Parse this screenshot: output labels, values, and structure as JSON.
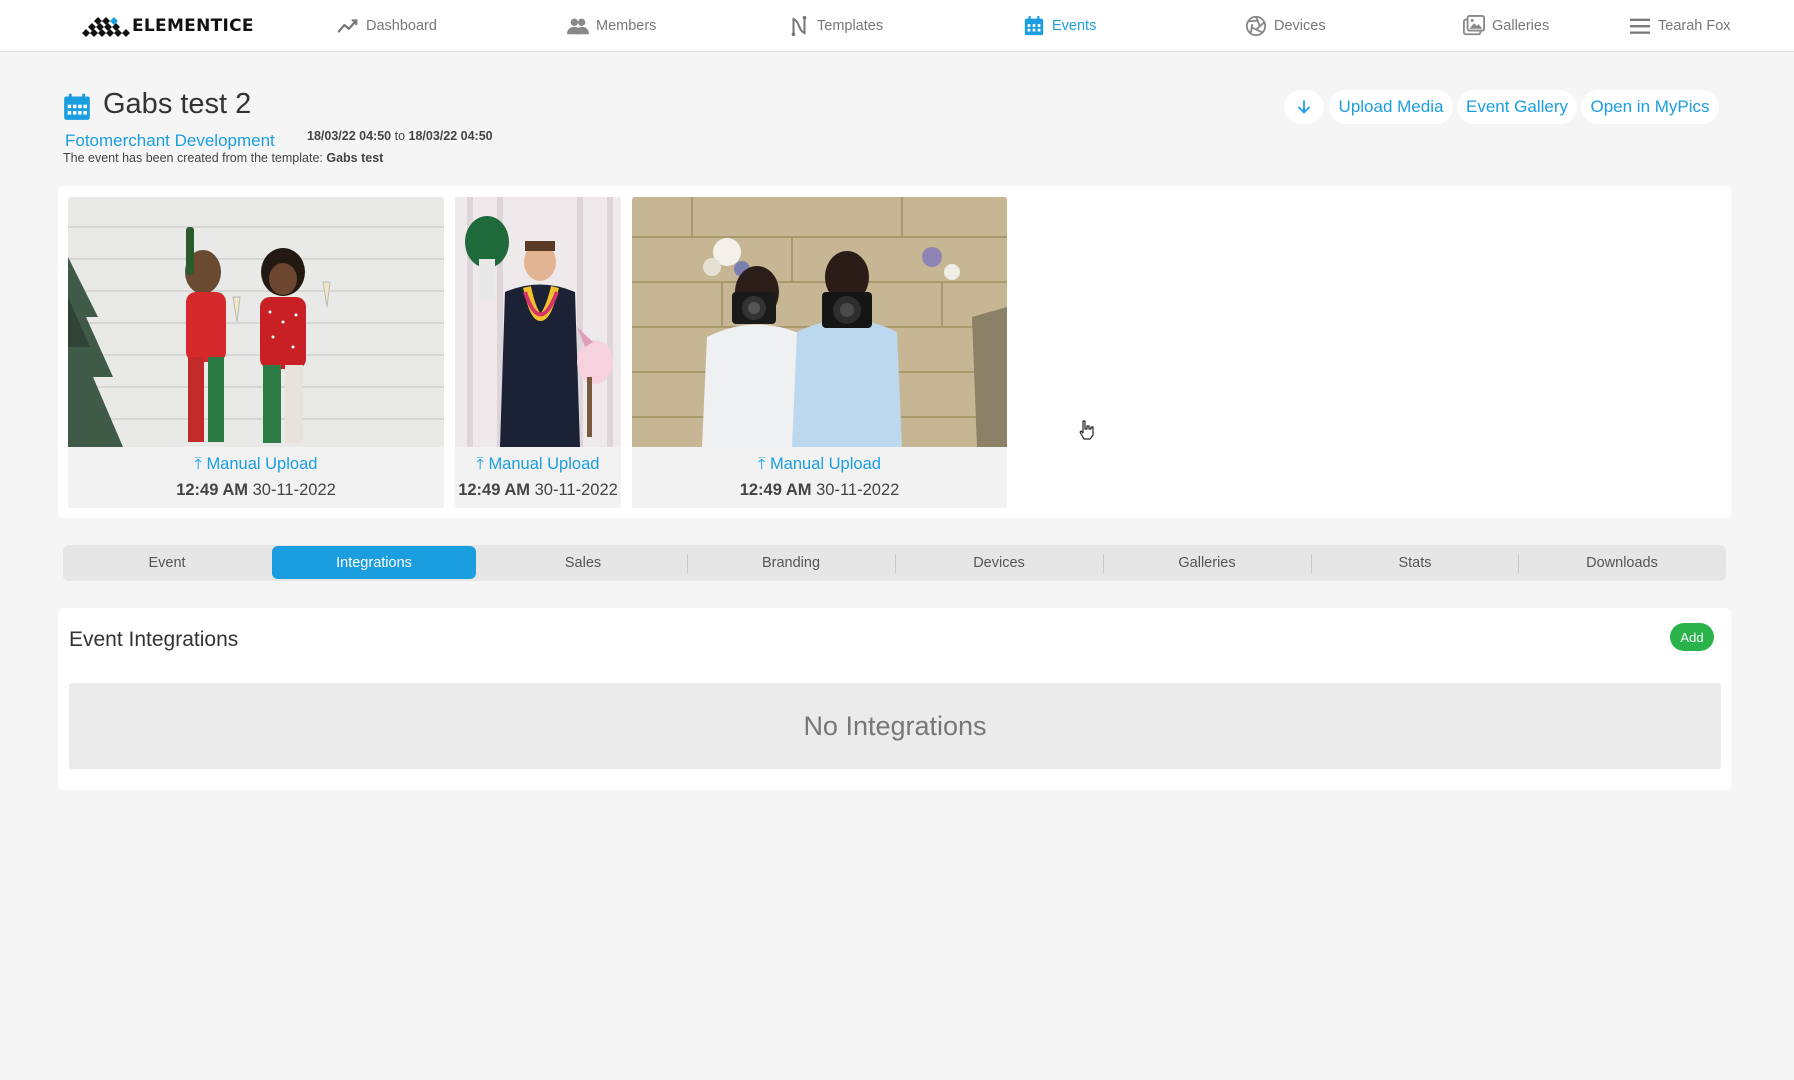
{
  "nav": {
    "brand": "ELEMENTICE",
    "items": [
      {
        "label": "Dashboard",
        "icon": "chart-line-icon"
      },
      {
        "label": "Members",
        "icon": "users-icon"
      },
      {
        "label": "Templates",
        "icon": "templates-icon"
      },
      {
        "label": "Events",
        "icon": "calendar-icon",
        "active": true
      },
      {
        "label": "Devices",
        "icon": "camera-aperture-icon"
      },
      {
        "label": "Galleries",
        "icon": "image-gallery-icon"
      }
    ],
    "user": "Tearah Fox"
  },
  "event": {
    "title": "Gabs test 2",
    "organization": "Fotomerchant Development",
    "start": "18/03/22 04:50",
    "to": "to",
    "end": "18/03/22 04:50",
    "template_prefix": "The event has been created from the template:",
    "template_name": "Gabs test"
  },
  "actions": {
    "download_icon": "arrow-down-icon",
    "upload_media": "Upload Media",
    "event_gallery": "Event Gallery",
    "open_in_mypics": "Open in MyPics"
  },
  "media": [
    {
      "source": "Manual Upload",
      "time": "12:49 AM",
      "date": "30-11-2022",
      "subject": "two women in red christmas sweaters holding champagne"
    },
    {
      "source": "Manual Upload",
      "time": "12:49 AM",
      "date": "30-11-2022",
      "subject": "man with boxing glove and lei holding unicorn"
    },
    {
      "source": "Manual Upload",
      "time": "12:49 AM",
      "date": "30-11-2022",
      "subject": "two men holding cameras in front of stone wall"
    }
  ],
  "tabs": [
    "Event",
    "Integrations",
    "Sales",
    "Branding",
    "Devices",
    "Galleries",
    "Stats",
    "Downloads"
  ],
  "active_tab": "Integrations",
  "integrations": {
    "title": "Event Integrations",
    "add_label": "Add",
    "empty_text": "No Integrations"
  },
  "colors": {
    "accent": "#1a9ee0",
    "add_green": "#2ab34a",
    "background": "#f5f5f5"
  }
}
